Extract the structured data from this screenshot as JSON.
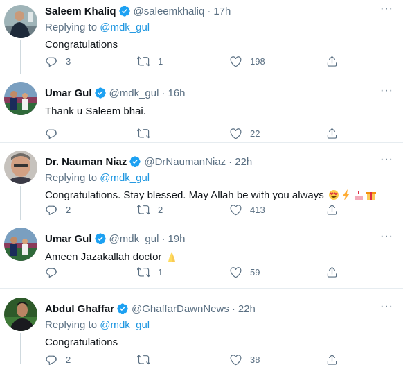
{
  "tweets": [
    {
      "name": "Saleem Khaliq",
      "handle": "@saleemkhaliq",
      "time": "17h",
      "replying_label": "Replying to",
      "replying_to": "@mdk_gul",
      "text": "Congratulations",
      "replies": "3",
      "retweets": "1",
      "likes": "198"
    },
    {
      "name": "Umar Gul",
      "handle": "@mdk_gul",
      "time": "16h",
      "text": "Thank u Saleem bhai.",
      "replies": "",
      "retweets": "",
      "likes": "22"
    },
    {
      "name": "Dr. Nauman Niaz",
      "handle": "@DrNaumanNiaz",
      "time": "22h",
      "replying_label": "Replying to",
      "replying_to": "@mdk_gul",
      "text": "Congratulations. Stay blessed. May Allah be with you always",
      "replies": "2",
      "retweets": "2",
      "likes": "413"
    },
    {
      "name": "Umar Gul",
      "handle": "@mdk_gul",
      "time": "19h",
      "text": "Ameen Jazakallah doctor",
      "replies": "",
      "retweets": "1",
      "likes": "59"
    },
    {
      "name": "Abdul Ghaffar",
      "handle": "@GhaffarDawnNews",
      "time": "22h",
      "replying_label": "Replying to",
      "replying_to": "@mdk_gul",
      "text": "Congratulations",
      "replies": "2",
      "retweets": "",
      "likes": "38"
    }
  ],
  "separator": "·",
  "colors": {
    "accent": "#1da1f2",
    "secondary_text": "#5b7083",
    "link": "#1b95e0"
  },
  "icons": [
    "more-icon",
    "verified-icon",
    "reply-icon",
    "retweet-icon",
    "like-icon",
    "share-icon"
  ]
}
